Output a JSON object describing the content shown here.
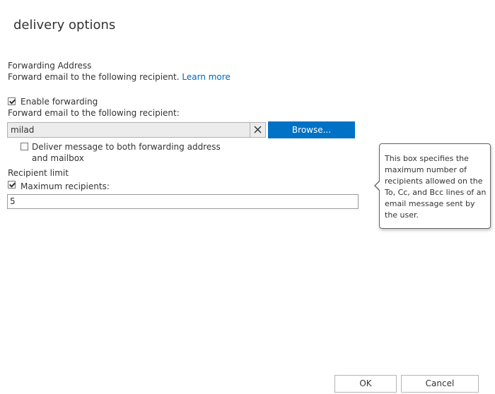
{
  "dialog": {
    "title": "delivery options"
  },
  "forwarding": {
    "section_title": "Forwarding Address",
    "description": "Forward email to the following recipient.",
    "learn_more": "Learn more",
    "enable_label": "Enable forwarding",
    "enable_checked": true,
    "recipient_label": "Forward email to the following recipient:",
    "recipient_value": "milad",
    "browse_label": "Browse...",
    "deliver_both_label": "Deliver message to both forwarding address and mailbox",
    "deliver_both_checked": false
  },
  "recipient_limit": {
    "section_title": "Recipient limit",
    "max_label": "Maximum recipients:",
    "max_checked": true,
    "max_value": "5"
  },
  "callout": {
    "text": "This box specifies the maximum number of recipients allowed on the To, Cc, and Bcc lines of an email message sent by the user."
  },
  "footer": {
    "ok_label": "OK",
    "cancel_label": "Cancel"
  },
  "colors": {
    "primary_button": "#0072c6",
    "link": "#0067b8",
    "text": "#333333"
  }
}
